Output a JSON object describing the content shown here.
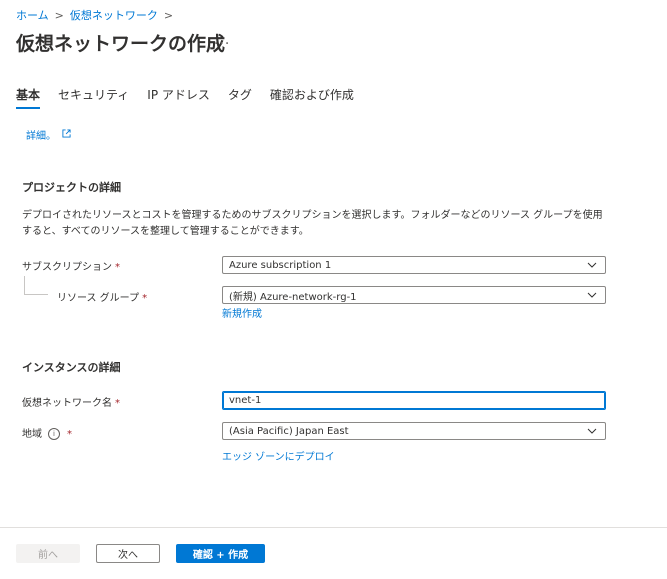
{
  "breadcrumb": {
    "home": "ホーム",
    "sep1": ">",
    "vnet": "仮想ネットワーク",
    "sep2": ">"
  },
  "page": {
    "title": "仮想ネットワークの作成",
    "more": "..."
  },
  "tabs": [
    {
      "label": "基本",
      "active": true
    },
    {
      "label": "セキュリティ",
      "active": false
    },
    {
      "label": "IP アドレス",
      "active": false
    },
    {
      "label": "タグ",
      "active": false
    },
    {
      "label": "確認および作成",
      "active": false
    }
  ],
  "learn_more": "詳細。",
  "project": {
    "heading": "プロジェクトの詳細",
    "description": "デプロイされたリソースとコストを管理するためのサブスクリプションを選択します。フォルダーなどのリソース グループを使用すると、すべてのリソースを整理して管理することができます。",
    "subscription_label": "サブスクリプション",
    "subscription_value": "Azure subscription 1",
    "rg_label": "リソース グループ",
    "rg_value": "(新規) Azure-network-rg-1",
    "create_new": "新規作成"
  },
  "instance": {
    "heading": "インスタンスの詳細",
    "name_label": "仮想ネットワーク名",
    "name_value": "vnet-1",
    "region_label": "地域",
    "region_value": "(Asia Pacific) Japan East",
    "edge_zone": "エッジ ゾーンにデプロイ"
  },
  "required_mark": "*",
  "footer": {
    "prev": "前へ",
    "next": "次へ",
    "create": "確認 + 作成"
  },
  "colors": {
    "accent": "#0078d4",
    "required": "#a4262c"
  }
}
